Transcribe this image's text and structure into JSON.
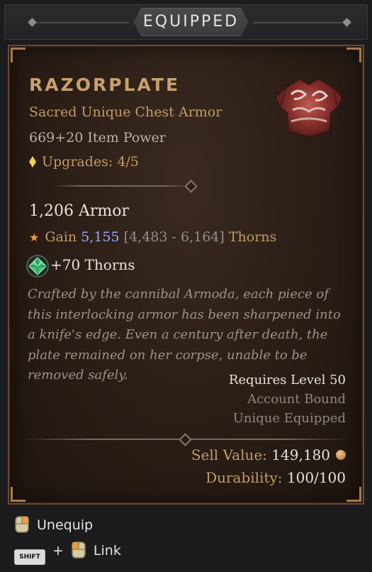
{
  "header": {
    "title": "EQUIPPED"
  },
  "item": {
    "name": "RAZORPLATE",
    "subtype": "Sacred Unique Chest Armor",
    "item_power": "669+20 Item Power",
    "upgrades": "Upgrades: 4/5",
    "armor": "1,206 Armor",
    "affix_gain_prefix": "Gain",
    "affix_gain_value": "5,155",
    "affix_gain_range": "[4,483 - 6,164]",
    "affix_gain_suffix": "Thorns",
    "affix_socket": "+70 Thorns",
    "flavor": "Crafted by the cannibal Armoda, each piece of this interlocking armor has been sharpened into a knife's edge. Even a century after death, the plate remained on her corpse, unable to be removed safely.",
    "requires_level": "Requires Level 50",
    "account_bound": "Account Bound",
    "unique_equipped": "Unique Equipped",
    "sell_label": "Sell Value:",
    "sell_value": "149,180",
    "durability_label": "Durability:",
    "durability_value": "100/100"
  },
  "actions": {
    "unequip": "Unequip",
    "shift_key": "SHIFT",
    "plus": "+",
    "link": "Link"
  },
  "colors": {
    "unique_gold": "#c7a06d",
    "affix_value": "#9ba6ff",
    "upgrade_icon": "#f3d54e"
  }
}
